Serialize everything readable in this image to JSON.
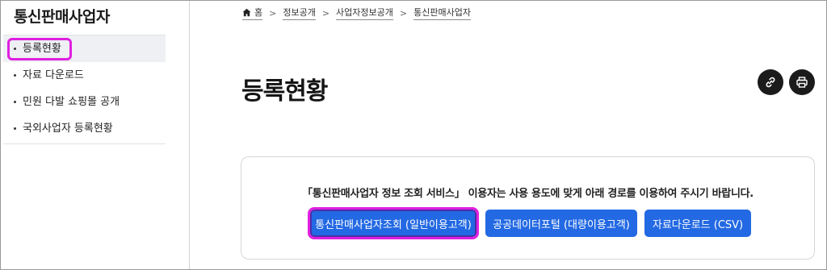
{
  "sidebar": {
    "title": "통신판매사업자",
    "items": [
      {
        "label": "등록현황",
        "active": true
      },
      {
        "label": "자료 다운로드",
        "active": false
      },
      {
        "label": "민원 다발 쇼핑몰 공개",
        "active": false
      },
      {
        "label": "국외사업자 등록현황",
        "active": false
      }
    ]
  },
  "breadcrumb": [
    "홈",
    "정보공개",
    "사업자정보공개",
    "통신판매사업자"
  ],
  "main": {
    "title": "등록현황",
    "link_icon": "link-icon",
    "print_icon": "print-icon",
    "notice": "「통신판매사업자 정보 조회 서비스」 이용자는 사용 용도에 맞게 아래 경로를 이용하여 주시기 바랍니다.",
    "buttons": [
      {
        "label": "통신판매사업자조회 (일반이용고객)"
      },
      {
        "label": "공공데이터포털 (대량이용고객)"
      },
      {
        "label": "자료다운로드 (CSV)"
      }
    ]
  },
  "colors": {
    "accent": "#2369e3",
    "highlight": "#e01fe0",
    "dark_button": "#1b1b1b"
  }
}
